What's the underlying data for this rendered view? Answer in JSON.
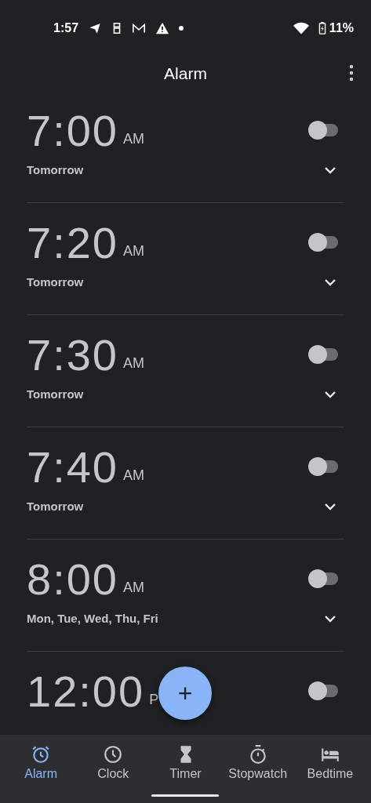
{
  "status_bar": {
    "time": "1:57",
    "battery": "11%"
  },
  "app_bar": {
    "title": "Alarm"
  },
  "alarms": [
    {
      "time": "7:00",
      "suffix": "AM",
      "on": false,
      "days": "Tomorrow"
    },
    {
      "time": "7:20",
      "suffix": "AM",
      "on": false,
      "days": "Tomorrow"
    },
    {
      "time": "7:30",
      "suffix": "AM",
      "on": false,
      "days": "Tomorrow"
    },
    {
      "time": "7:40",
      "suffix": "AM",
      "on": false,
      "days": "Tomorrow"
    },
    {
      "time": "8:00",
      "suffix": "AM",
      "on": false,
      "days": "Mon, Tue, Wed, Thu, Fri"
    },
    {
      "time": "12:00",
      "suffix": "P",
      "on": false
    }
  ],
  "fab": {
    "label": "+"
  },
  "nav": [
    {
      "label": "Alarm",
      "kind": "alarm",
      "selected": true
    },
    {
      "label": "Clock",
      "kind": "clock",
      "selected": false
    },
    {
      "label": "Timer",
      "kind": "timer",
      "selected": false
    },
    {
      "label": "Stopwatch",
      "kind": "stopwatch",
      "selected": false
    },
    {
      "label": "Bedtime",
      "kind": "bedtime",
      "selected": false
    }
  ]
}
